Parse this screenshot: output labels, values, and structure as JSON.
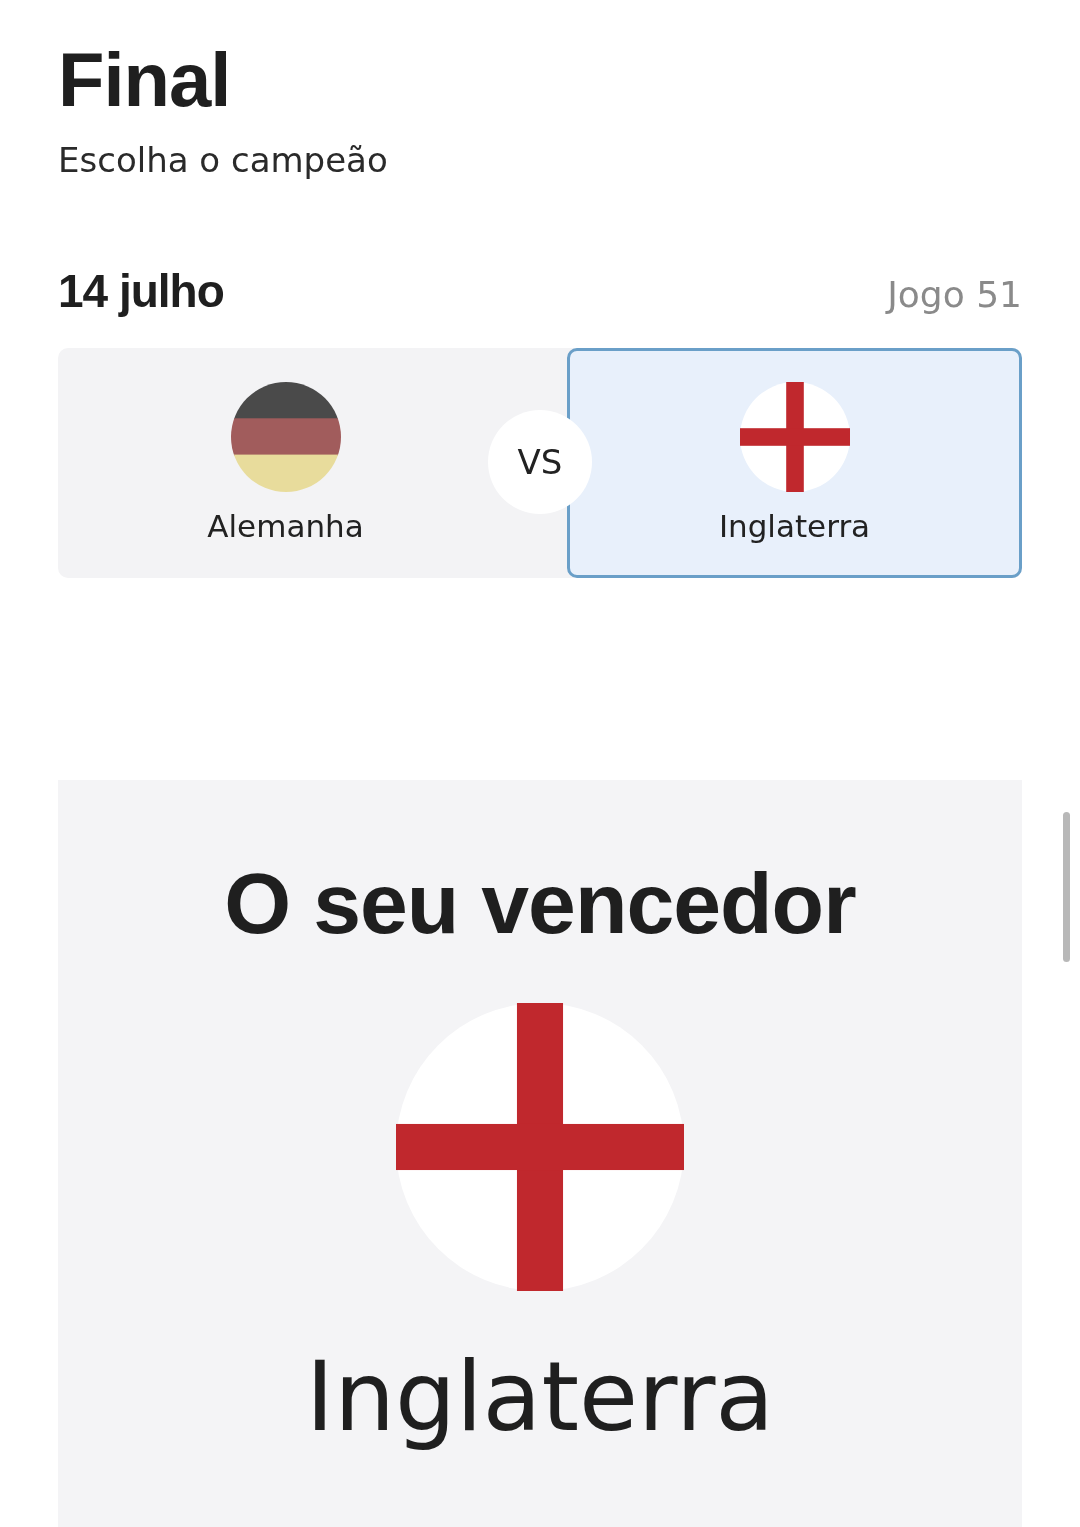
{
  "header": {
    "title": "Final",
    "subtitle": "Escolha o campeão"
  },
  "match": {
    "date": "14 julho",
    "game": "Jogo 51",
    "vs": "VS",
    "teams": [
      {
        "name": "Alemanha",
        "flag": {
          "kind": "germany"
        },
        "selected": false
      },
      {
        "name": "Inglaterra",
        "flag": {
          "kind": "england"
        },
        "selected": true
      }
    ]
  },
  "winner": {
    "heading": "O seu vencedor",
    "name": "Inglaterra",
    "flag": {
      "kind": "england"
    }
  }
}
